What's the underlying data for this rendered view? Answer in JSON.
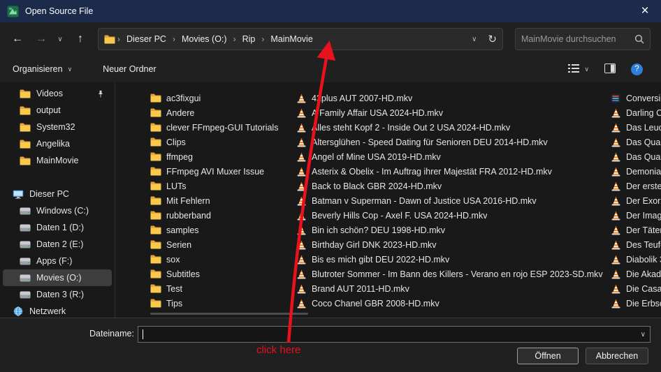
{
  "window": {
    "title": "Open Source File",
    "close_icon": "×"
  },
  "nav": {
    "back_icon": "←",
    "forward_icon": "→",
    "recent_chevron": "∨",
    "up_icon": "↑",
    "breadcrumb": [
      "Dieser PC",
      "Movies (O:)",
      "Rip",
      "MainMovie"
    ],
    "breadcrumb_separator": "›",
    "address_chevron": "∨",
    "refresh_icon": "↻",
    "search_placeholder": "MainMovie durchsuchen"
  },
  "toolbar": {
    "organize_label": "Organisieren",
    "organize_chevron": "∨",
    "new_folder_label": "Neuer Ordner",
    "view_chevron": "∨",
    "help_glyph": "?"
  },
  "sidebar": {
    "quick_access": [
      {
        "label": "Videos",
        "icon": "folder",
        "indent": true,
        "pinned": true
      },
      {
        "label": "output",
        "icon": "folder",
        "indent": true
      },
      {
        "label": "System32",
        "icon": "folder",
        "indent": true
      },
      {
        "label": "Angelika",
        "icon": "folder",
        "indent": true
      },
      {
        "label": "MainMovie",
        "icon": "folder",
        "indent": true
      }
    ],
    "this_pc": [
      {
        "label": "Dieser PC",
        "icon": "computer"
      },
      {
        "label": "Windows (C:)",
        "icon": "drive",
        "indent": true
      },
      {
        "label": "Daten 1 (D:)",
        "icon": "drive",
        "indent": true
      },
      {
        "label": "Daten 2 (E:)",
        "icon": "drive",
        "indent": true
      },
      {
        "label": "Apps (F:)",
        "icon": "drive",
        "indent": true
      },
      {
        "label": "Movies (O:)",
        "icon": "drive",
        "indent": true,
        "selected": true
      },
      {
        "label": "Daten 3 (R:)",
        "icon": "drive",
        "indent": true
      },
      {
        "label": "Netzwerk",
        "icon": "network"
      }
    ]
  },
  "files": {
    "folders": [
      "ac3fixgui",
      "Andere",
      "clever FFmpeg-GUI Tutorials",
      "Clips",
      "ffmpeg",
      "FFmpeg AVI Muxer Issue",
      "LUTs",
      "Mit Fehlern",
      "rubberband",
      "samples",
      "Serien",
      "sox",
      "Subtitles",
      "Test",
      "Tips"
    ],
    "movies": [
      "42plus AUT 2007-HD.mkv",
      "A Family Affair USA 2024-HD.mkv",
      "Alles steht Kopf 2 - Inside Out 2 USA 2024-HD.mkv",
      "Altersglühen - Speed Dating für Senioren DEU 2014-HD.mkv",
      "Angel of Mine USA 2019-HD.mkv",
      "Asterix & Obelix - Im Auftrag ihrer Majestät FRA 2012-HD.mkv",
      "Back to Black GBR 2024-HD.mkv",
      "Batman v Superman - Dawn of Justice USA 2016-HD.mkv",
      "Beverly Hills Cop - Axel F. USA 2024-HD.mkv",
      "Bin ich schön? DEU 1998-HD.mkv",
      "Birthday Girl DNK 2023-HD.mkv",
      "Bis es mich gibt DEU 2022-HD.mkv",
      "Blutroter Sommer - Im Bann des Killers - Verano en rojo ESP 2023-SD.mkv",
      "Brand AUT 2011-HD.mkv",
      "Coco Chanel GBR 2008-HD.mkv"
    ],
    "right_column": [
      {
        "label": "Conversio",
        "icon": "app"
      },
      {
        "label": "Darling Co",
        "icon": "cone"
      },
      {
        "label": "Das Leuch",
        "icon": "cone"
      },
      {
        "label": "Das Quart",
        "icon": "cone"
      },
      {
        "label": "Das Quart",
        "icon": "cone"
      },
      {
        "label": "Demoniac",
        "icon": "cone"
      },
      {
        "label": "Der erste F",
        "icon": "cone"
      },
      {
        "label": "Der Exorzis",
        "icon": "cone"
      },
      {
        "label": "Der Imagi",
        "icon": "cone"
      },
      {
        "label": "Der Täter",
        "icon": "cone"
      },
      {
        "label": "Des Teufel",
        "icon": "cone"
      },
      {
        "label": "Diabolik 3",
        "icon": "cone"
      },
      {
        "label": "Die Akade",
        "icon": "cone"
      },
      {
        "label": "Die Casag",
        "icon": "cone"
      },
      {
        "label": "Die Erbsch",
        "icon": "cone"
      }
    ]
  },
  "footer": {
    "filename_label": "Dateiname:",
    "filename_value": "",
    "combo_chevron": "∨",
    "open_label": "Öffnen",
    "cancel_label": "Abbrechen"
  },
  "annotation": {
    "text": "click here",
    "color": "#e8121c"
  },
  "colors": {
    "titlebar": "#1c2b4b",
    "dialog_bg": "#202020",
    "list_bg": "#191919",
    "selection_bg": "#3d3d3d",
    "annotation_red": "#e8121c",
    "folder_yellow": "#f8c94a",
    "cone_orange": "#f07e13",
    "help_blue": "#2f7ed8"
  }
}
